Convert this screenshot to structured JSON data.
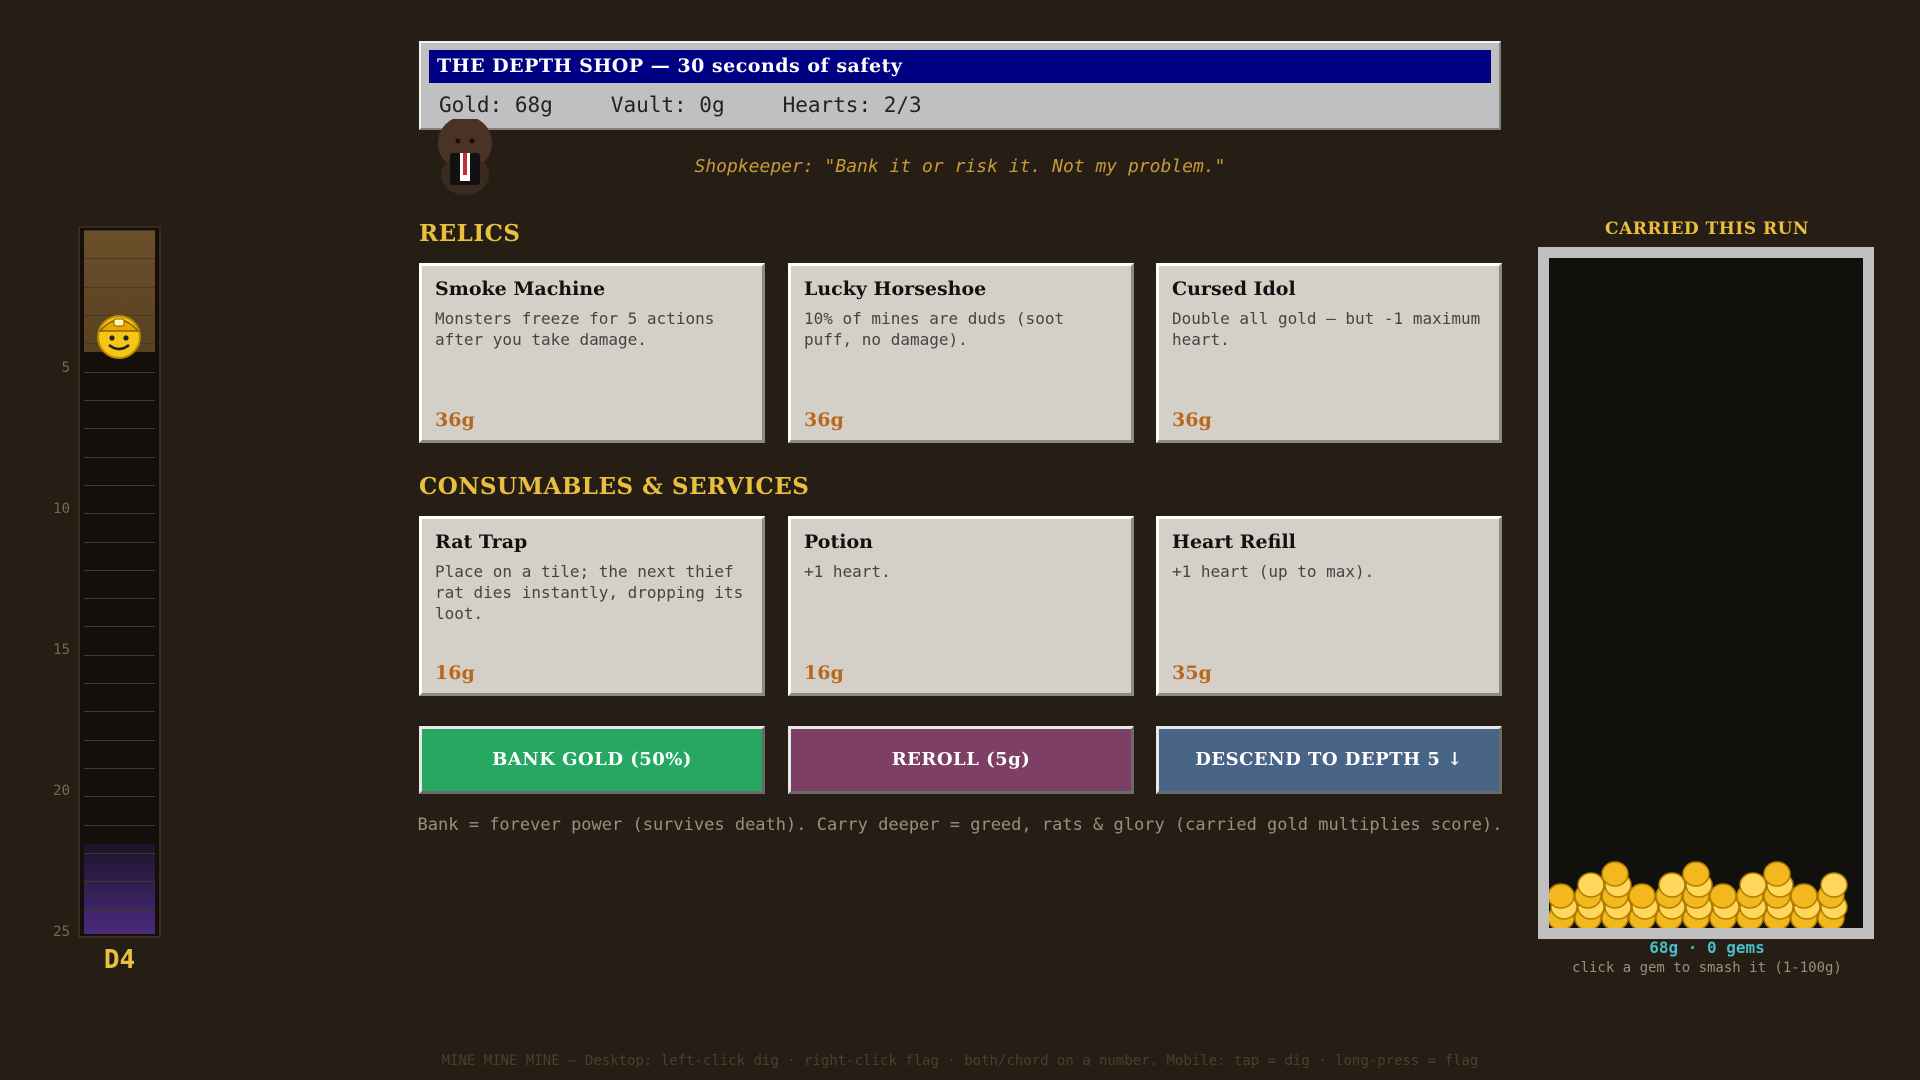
{
  "header": {
    "title": "THE DEPTH SHOP — 30 seconds of safety",
    "gold": "Gold: 68g",
    "vault": "Vault: 0g",
    "hearts": "Hearts: 2/3"
  },
  "shopkeeper_quote": "Shopkeeper: \"Bank it or risk it. Not my problem.\"",
  "sections": {
    "relics": "RELICS",
    "consumables": "CONSUMABLES & SERVICES"
  },
  "relics": [
    {
      "name": "Smoke Machine",
      "desc": "Monsters freeze for 5 actions after you take damage.",
      "price": "36g"
    },
    {
      "name": "Lucky Horseshoe",
      "desc": "10% of mines are duds (soot puff, no damage).",
      "price": "36g"
    },
    {
      "name": "Cursed Idol",
      "desc": "Double all gold — but -1 maximum heart.",
      "price": "36g"
    }
  ],
  "consumables": [
    {
      "name": "Rat Trap",
      "desc": "Place on a tile; the next thief rat dies instantly, dropping its loot.",
      "price": "16g"
    },
    {
      "name": "Potion",
      "desc": "+1 heart.",
      "price": "16g"
    },
    {
      "name": "Heart Refill",
      "desc": "+1 heart (up to max).",
      "price": "35g"
    }
  ],
  "buttons": {
    "bank": "BANK GOLD (50%)",
    "reroll": "REROLL (5g)",
    "descend": "DESCEND TO DEPTH 5 ↓"
  },
  "footnote": "Bank = forever power (survives death). Carry deeper = greed, rats & glory (carried gold multiplies score).",
  "depth": {
    "label": "D4",
    "current": 4,
    "max": 25,
    "ticks": [
      "5",
      "10",
      "15",
      "20",
      "25"
    ]
  },
  "carried": {
    "title": "CARRIED THIS RUN",
    "summary": "68g · 0 gems",
    "hint": "click a gem to smash it (1-100g)"
  },
  "bottom_help": "MINE MINE MINE — Desktop: left-click dig · right-click flag · both/chord on a number. Mobile: tap = dig · long-press = flag",
  "colors": {
    "background": "#261d14",
    "accent_gold": "#e8c040",
    "price": "#b8681c",
    "bank": "#27a862",
    "reroll": "#7d3f63",
    "descend": "#486587",
    "title_bar": "#000082"
  },
  "icons": {
    "miner": "miner-face-icon",
    "shopkeeper": "shopkeeper-icon",
    "coins": "gold-coin-icon"
  }
}
